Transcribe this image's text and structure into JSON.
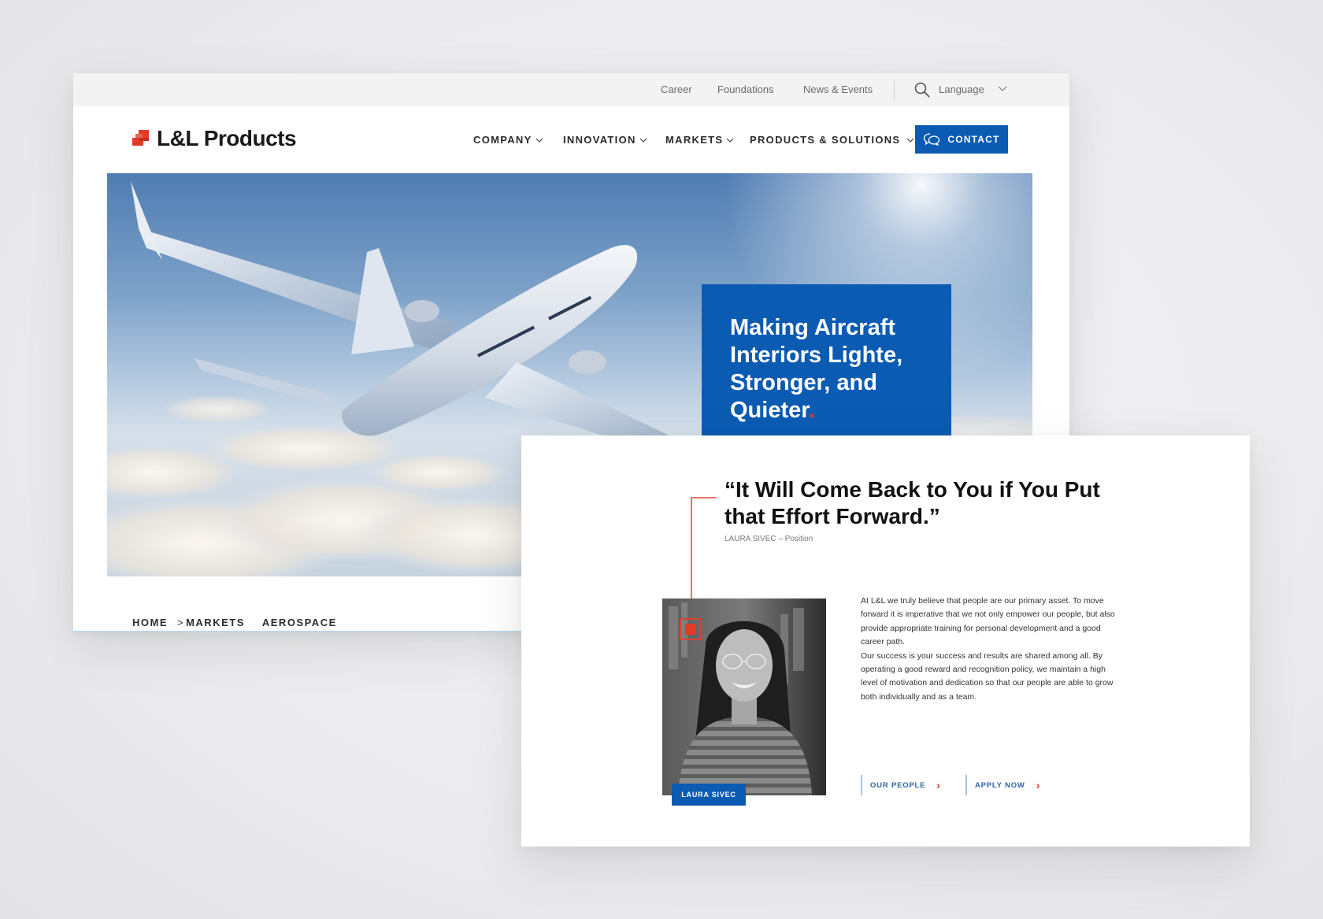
{
  "utility_nav": {
    "links": [
      "Career",
      "Foundations",
      "News & Events"
    ],
    "search_icon": "search-icon",
    "language_label": "Language",
    "language_icon": "chevron-down-icon"
  },
  "brand": {
    "logo_text": "L&L Products",
    "logo_icon": "stacked-squares-logo",
    "accent_color": "#e23b26",
    "primary_color": "#0b5bb3"
  },
  "main_nav": {
    "items": [
      {
        "label": "COMPANY",
        "icon": "chevron-down-icon"
      },
      {
        "label": "INNOVATION",
        "icon": "chevron-down-icon"
      },
      {
        "label": "MARKETS",
        "icon": "chevron-down-icon"
      },
      {
        "label": "PRODUCTS & SOLUTIONS",
        "icon": "chevron-down-icon"
      }
    ],
    "contact": {
      "label": "CONTACT",
      "icon": "chat-bubbles-icon"
    }
  },
  "hero": {
    "image_description": "Airplane flying above clouds",
    "title": "Making Aircraft Interiors Lighte, Stronger, and Quieter",
    "title_dot": "."
  },
  "breadcrumb": {
    "items": [
      "HOME",
      "MARKETS",
      "AEROSPACE"
    ],
    "separator": ">"
  },
  "people": {
    "quote": "“It Will Come Back to You if You Put that Effort Forward.”",
    "attribution": "LAURA SIVEC – Position",
    "portrait_description": "Black and white portrait of smiling woman with glasses",
    "name_tag": "LAURA SIVEC",
    "paragraphs": [
      "At L&L we truly believe that people are our primary asset. To move forward it is imperative that we not only empower our people, but also provide appropriate training for personal development and a good career path.",
      "Our success is your success and results are shared among all. By operating a good reward and recognition policy, we maintain a high level of motivation and dedication so that our people are able to grow both individually and as a team."
    ],
    "ctas": [
      {
        "label": "OUR PEOPLE",
        "icon": "chevron-right-icon",
        "arrow": "›"
      },
      {
        "label": "APPLY NOW",
        "icon": "chevron-right-icon",
        "arrow": "›"
      }
    ]
  }
}
